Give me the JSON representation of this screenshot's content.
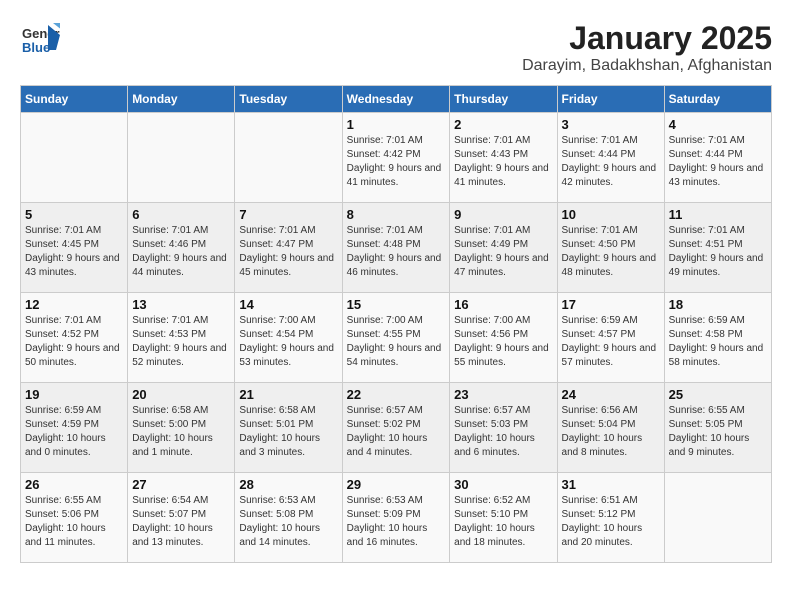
{
  "header": {
    "logo_general": "General",
    "logo_blue": "Blue",
    "title": "January 2025",
    "subtitle": "Darayim, Badakhshan, Afghanistan"
  },
  "calendar": {
    "days_of_week": [
      "Sunday",
      "Monday",
      "Tuesday",
      "Wednesday",
      "Thursday",
      "Friday",
      "Saturday"
    ],
    "weeks": [
      [
        {
          "day": "",
          "info": ""
        },
        {
          "day": "",
          "info": ""
        },
        {
          "day": "",
          "info": ""
        },
        {
          "day": "1",
          "info": "Sunrise: 7:01 AM\nSunset: 4:42 PM\nDaylight: 9 hours and 41 minutes."
        },
        {
          "day": "2",
          "info": "Sunrise: 7:01 AM\nSunset: 4:43 PM\nDaylight: 9 hours and 41 minutes."
        },
        {
          "day": "3",
          "info": "Sunrise: 7:01 AM\nSunset: 4:44 PM\nDaylight: 9 hours and 42 minutes."
        },
        {
          "day": "4",
          "info": "Sunrise: 7:01 AM\nSunset: 4:44 PM\nDaylight: 9 hours and 43 minutes."
        }
      ],
      [
        {
          "day": "5",
          "info": "Sunrise: 7:01 AM\nSunset: 4:45 PM\nDaylight: 9 hours and 43 minutes."
        },
        {
          "day": "6",
          "info": "Sunrise: 7:01 AM\nSunset: 4:46 PM\nDaylight: 9 hours and 44 minutes."
        },
        {
          "day": "7",
          "info": "Sunrise: 7:01 AM\nSunset: 4:47 PM\nDaylight: 9 hours and 45 minutes."
        },
        {
          "day": "8",
          "info": "Sunrise: 7:01 AM\nSunset: 4:48 PM\nDaylight: 9 hours and 46 minutes."
        },
        {
          "day": "9",
          "info": "Sunrise: 7:01 AM\nSunset: 4:49 PM\nDaylight: 9 hours and 47 minutes."
        },
        {
          "day": "10",
          "info": "Sunrise: 7:01 AM\nSunset: 4:50 PM\nDaylight: 9 hours and 48 minutes."
        },
        {
          "day": "11",
          "info": "Sunrise: 7:01 AM\nSunset: 4:51 PM\nDaylight: 9 hours and 49 minutes."
        }
      ],
      [
        {
          "day": "12",
          "info": "Sunrise: 7:01 AM\nSunset: 4:52 PM\nDaylight: 9 hours and 50 minutes."
        },
        {
          "day": "13",
          "info": "Sunrise: 7:01 AM\nSunset: 4:53 PM\nDaylight: 9 hours and 52 minutes."
        },
        {
          "day": "14",
          "info": "Sunrise: 7:00 AM\nSunset: 4:54 PM\nDaylight: 9 hours and 53 minutes."
        },
        {
          "day": "15",
          "info": "Sunrise: 7:00 AM\nSunset: 4:55 PM\nDaylight: 9 hours and 54 minutes."
        },
        {
          "day": "16",
          "info": "Sunrise: 7:00 AM\nSunset: 4:56 PM\nDaylight: 9 hours and 55 minutes."
        },
        {
          "day": "17",
          "info": "Sunrise: 6:59 AM\nSunset: 4:57 PM\nDaylight: 9 hours and 57 minutes."
        },
        {
          "day": "18",
          "info": "Sunrise: 6:59 AM\nSunset: 4:58 PM\nDaylight: 9 hours and 58 minutes."
        }
      ],
      [
        {
          "day": "19",
          "info": "Sunrise: 6:59 AM\nSunset: 4:59 PM\nDaylight: 10 hours and 0 minutes."
        },
        {
          "day": "20",
          "info": "Sunrise: 6:58 AM\nSunset: 5:00 PM\nDaylight: 10 hours and 1 minute."
        },
        {
          "day": "21",
          "info": "Sunrise: 6:58 AM\nSunset: 5:01 PM\nDaylight: 10 hours and 3 minutes."
        },
        {
          "day": "22",
          "info": "Sunrise: 6:57 AM\nSunset: 5:02 PM\nDaylight: 10 hours and 4 minutes."
        },
        {
          "day": "23",
          "info": "Sunrise: 6:57 AM\nSunset: 5:03 PM\nDaylight: 10 hours and 6 minutes."
        },
        {
          "day": "24",
          "info": "Sunrise: 6:56 AM\nSunset: 5:04 PM\nDaylight: 10 hours and 8 minutes."
        },
        {
          "day": "25",
          "info": "Sunrise: 6:55 AM\nSunset: 5:05 PM\nDaylight: 10 hours and 9 minutes."
        }
      ],
      [
        {
          "day": "26",
          "info": "Sunrise: 6:55 AM\nSunset: 5:06 PM\nDaylight: 10 hours and 11 minutes."
        },
        {
          "day": "27",
          "info": "Sunrise: 6:54 AM\nSunset: 5:07 PM\nDaylight: 10 hours and 13 minutes."
        },
        {
          "day": "28",
          "info": "Sunrise: 6:53 AM\nSunset: 5:08 PM\nDaylight: 10 hours and 14 minutes."
        },
        {
          "day": "29",
          "info": "Sunrise: 6:53 AM\nSunset: 5:09 PM\nDaylight: 10 hours and 16 minutes."
        },
        {
          "day": "30",
          "info": "Sunrise: 6:52 AM\nSunset: 5:10 PM\nDaylight: 10 hours and 18 minutes."
        },
        {
          "day": "31",
          "info": "Sunrise: 6:51 AM\nSunset: 5:12 PM\nDaylight: 10 hours and 20 minutes."
        },
        {
          "day": "",
          "info": ""
        }
      ]
    ]
  }
}
